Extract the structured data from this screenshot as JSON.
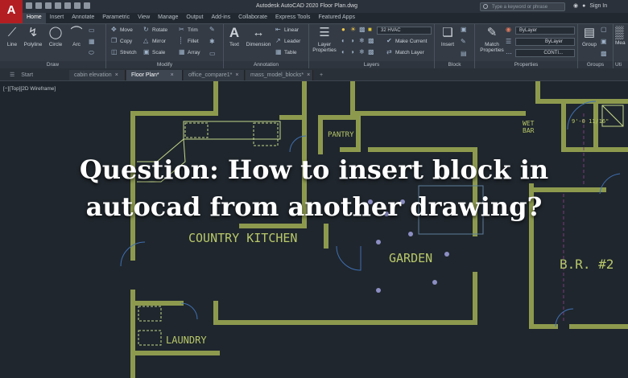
{
  "app": {
    "logo": "A",
    "title": "Autodesk AutoCAD 2020    Floor Plan.dwg",
    "search_placeholder": "Type a keyword or phrase",
    "sign_in": "Sign In",
    "accent_color": "#b21e22"
  },
  "menu_tabs": [
    "Home",
    "Insert",
    "Annotate",
    "Parametric",
    "View",
    "Manage",
    "Output",
    "Add-ins",
    "Collaborate",
    "Express Tools",
    "Featured Apps"
  ],
  "ribbon": {
    "draw": {
      "title": "Draw",
      "tools": [
        "Line",
        "Polyline",
        "Circle",
        "Arc"
      ]
    },
    "modify": {
      "title": "Modify",
      "col1": [
        "Move",
        "Copy",
        "Stretch"
      ],
      "col2": [
        "Rotate",
        "Mirror",
        "Scale"
      ],
      "col3": [
        "Trim",
        "Fillet",
        "Array"
      ]
    },
    "annotation": {
      "title": "Annotation",
      "tools": [
        "Text",
        "Dimension"
      ],
      "rows": [
        "Linear",
        "Leader",
        "Table"
      ]
    },
    "layers": {
      "title": "Layers",
      "tool": "Layer Properties",
      "layer_value": "32 HVAC",
      "rows": [
        "Make Current",
        "Match Layer"
      ]
    },
    "block": {
      "title": "Block",
      "tool": "Insert"
    },
    "properties": {
      "title": "Properties",
      "tool": "Match Properties",
      "rows": [
        "ByLayer",
        "ByLayer",
        "CONTI..."
      ]
    },
    "groups": {
      "title": "Groups",
      "tool": "Group"
    },
    "utilities": {
      "title": "Uti",
      "tool": "Mea"
    }
  },
  "doc_tabs": [
    {
      "label": "Start",
      "active": false
    },
    {
      "label": "cabin elevation",
      "active": false
    },
    {
      "label": "Floor Plan*",
      "active": true
    },
    {
      "label": "office_compare1*",
      "active": false
    },
    {
      "label": "mass_model_blocks*",
      "active": false
    }
  ],
  "viewport": {
    "label": "[−][Top][2D Wireframe]",
    "room_labels": [
      "PANTRY",
      "WET",
      "BAR",
      "9'-0 11/16\"",
      "COUNTRY KITCHEN",
      "GARDEN",
      "B.R. #2",
      "LAUNDRY"
    ]
  },
  "headline": {
    "line1": "Question: How to insert block in",
    "line2": "autocad from another drawing?"
  }
}
